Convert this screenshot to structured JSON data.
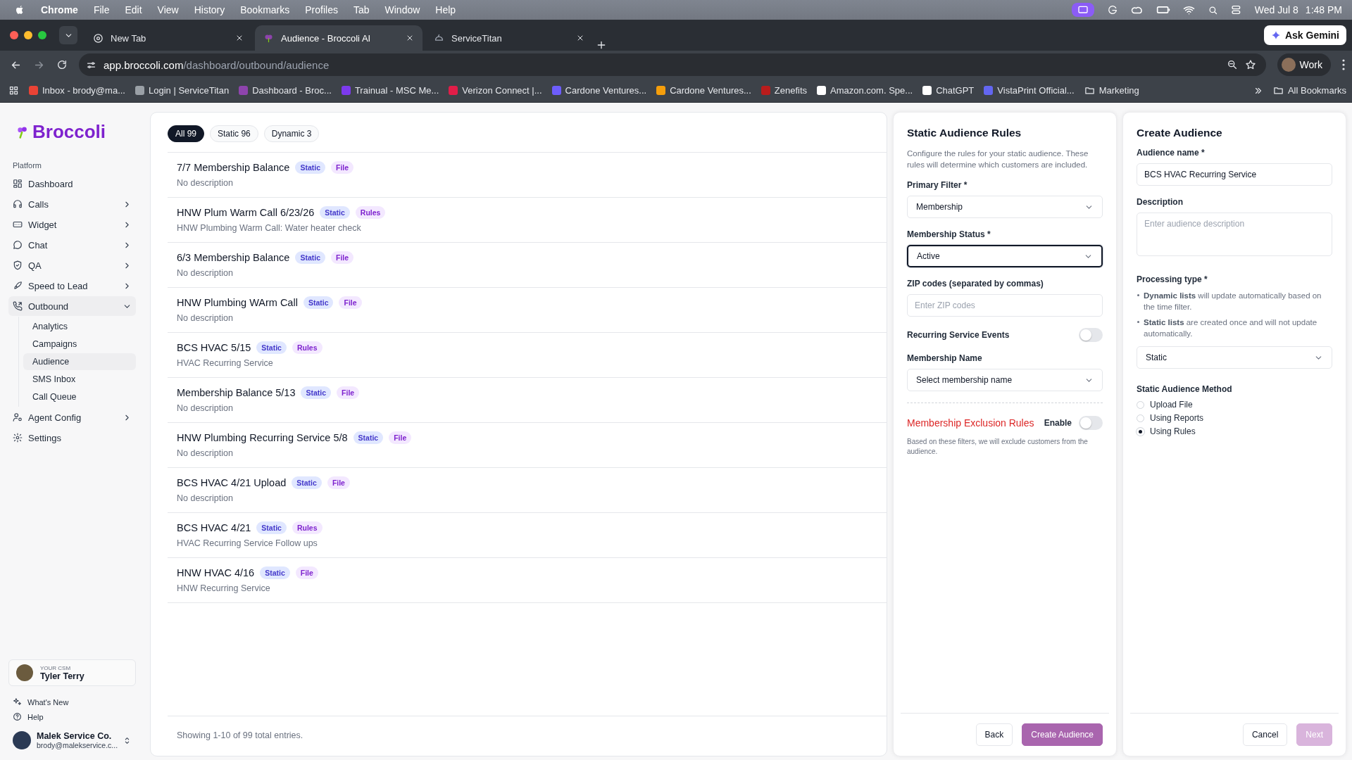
{
  "menubar": {
    "app": "Chrome",
    "items": [
      "File",
      "Edit",
      "View",
      "History",
      "Bookmarks",
      "Profiles",
      "Tab",
      "Window",
      "Help"
    ],
    "date": "Wed Jul 8",
    "time": "1:48 PM"
  },
  "browser_tabs": [
    {
      "title": "New Tab",
      "selected": false
    },
    {
      "title": "Audience - Broccoli AI",
      "selected": true
    },
    {
      "title": "ServiceTitan",
      "selected": false
    }
  ],
  "ask_gemini": "Ask Gemini",
  "address": {
    "host": "app.broccoli.com",
    "path": "/dashboard/outbound/audience"
  },
  "profile": "Work",
  "bookmarks": [
    "Inbox - brody@ma...",
    "Login | ServiceTitan",
    "Dashboard - Broc...",
    "Trainual - MSC Me...",
    "Verizon Connect |...",
    "Cardone Ventures...",
    "Cardone Ventures...",
    "Zenefits",
    "Amazon.com. Spe...",
    "ChatGPT",
    "VistaPrint Official...",
    "Marketing"
  ],
  "all_bookmarks": "All Bookmarks",
  "sidebar": {
    "brand": "Broccoli",
    "section": "Platform",
    "items": [
      {
        "label": "Dashboard",
        "kind": "link"
      },
      {
        "label": "Calls",
        "kind": "group",
        "expanded": false
      },
      {
        "label": "Widget",
        "kind": "group",
        "expanded": false
      },
      {
        "label": "Chat",
        "kind": "group",
        "expanded": false
      },
      {
        "label": "QA",
        "kind": "group",
        "expanded": false
      },
      {
        "label": "Speed to Lead",
        "kind": "group",
        "expanded": false
      },
      {
        "label": "Outbound",
        "kind": "group",
        "expanded": true,
        "children": [
          {
            "label": "Analytics",
            "selected": false
          },
          {
            "label": "Campaigns",
            "selected": false
          },
          {
            "label": "Audience",
            "selected": true
          },
          {
            "label": "SMS Inbox",
            "selected": false
          },
          {
            "label": "Call Queue",
            "selected": false
          }
        ]
      },
      {
        "label": "Agent Config",
        "kind": "group",
        "expanded": false
      },
      {
        "label": "Settings",
        "kind": "link"
      }
    ],
    "csm": {
      "caption": "YOUR CSM",
      "name": "Tyler Terry"
    },
    "footer_links": [
      "What's New",
      "Help"
    ],
    "account": {
      "name": "Malek Service Co.",
      "email": "brody@malekservice.c..."
    }
  },
  "filters": [
    {
      "label": "All 99",
      "selected": true
    },
    {
      "label": "Static 96",
      "selected": false
    },
    {
      "label": "Dynamic 3",
      "selected": false
    }
  ],
  "audiences": [
    {
      "title": "7/7 Membership Balance",
      "tags": [
        {
          "label": "Static",
          "kind": "type"
        },
        {
          "label": "File",
          "kind": "source"
        }
      ],
      "description": "No description"
    },
    {
      "title": "HNW Plum Warm Call 6/23/26",
      "tags": [
        {
          "label": "Static",
          "kind": "type"
        },
        {
          "label": "Rules",
          "kind": "source"
        }
      ],
      "description": "HNW Plumbing Warm Call: Water heater check"
    },
    {
      "title": "6/3 Membership Balance",
      "tags": [
        {
          "label": "Static",
          "kind": "type"
        },
        {
          "label": "File",
          "kind": "source"
        }
      ],
      "description": "No description"
    },
    {
      "title": "HNW Plumbing WArm Call",
      "tags": [
        {
          "label": "Static",
          "kind": "type"
        },
        {
          "label": "File",
          "kind": "source"
        }
      ],
      "description": "No description"
    },
    {
      "title": "BCS HVAC 5/15",
      "tags": [
        {
          "label": "Static",
          "kind": "type"
        },
        {
          "label": "Rules",
          "kind": "source"
        }
      ],
      "description": "HVAC Recurring Service"
    },
    {
      "title": "Membership Balance 5/13",
      "tags": [
        {
          "label": "Static",
          "kind": "type"
        },
        {
          "label": "File",
          "kind": "source"
        }
      ],
      "description": "No description"
    },
    {
      "title": "HNW Plumbing Recurring Service 5/8",
      "tags": [
        {
          "label": "Static",
          "kind": "type"
        },
        {
          "label": "File",
          "kind": "source"
        }
      ],
      "description": "No description"
    },
    {
      "title": "BCS HVAC 4/21 Upload",
      "tags": [
        {
          "label": "Static",
          "kind": "type"
        },
        {
          "label": "File",
          "kind": "source"
        }
      ],
      "description": "No description"
    },
    {
      "title": "BCS HVAC 4/21",
      "tags": [
        {
          "label": "Static",
          "kind": "type"
        },
        {
          "label": "Rules",
          "kind": "source"
        }
      ],
      "description": "HVAC Recurring Service Follow ups"
    },
    {
      "title": "HNW HVAC 4/16",
      "tags": [
        {
          "label": "Static",
          "kind": "type"
        },
        {
          "label": "File",
          "kind": "source"
        }
      ],
      "description": "HNW Recurring Service"
    }
  ],
  "list_footer": "Showing 1-10 of 99 total entries.",
  "rules_panel": {
    "title": "Static Audience Rules",
    "description": "Configure the rules for your static audience. These rules will determine which customers are included.",
    "fields": [
      {
        "kind": "select",
        "label": "Primary Filter *",
        "value": "Membership",
        "focused": false
      },
      {
        "kind": "select",
        "label": "Membership Status *",
        "value": "Active",
        "focused": true
      },
      {
        "kind": "input",
        "label": "ZIP codes (separated by commas)",
        "placeholder": "Enter ZIP codes"
      },
      {
        "kind": "toggle",
        "label": "Recurring Service Events",
        "on": false
      },
      {
        "kind": "select",
        "label": "Membership Name",
        "value": "Select membership name",
        "focused": false
      }
    ],
    "exclusion": {
      "title": "Membership Exclusion Rules",
      "enable_label": "Enable",
      "on": false,
      "note": "Based on these filters, we will exclude customers from the audience."
    },
    "back": "Back",
    "submit": "Create Audience"
  },
  "create_panel": {
    "title": "Create Audience",
    "name_field": {
      "label": "Audience name *",
      "value": "BCS HVAC Recurring Service"
    },
    "description_field": {
      "label": "Description",
      "placeholder": "Enter audience description"
    },
    "processing": {
      "label": "Processing type *",
      "bullets": [
        "**Dynamic lists** will update automatically based on the time filter.",
        "**Static lists** are created once and will not update automatically."
      ],
      "value": "Static"
    },
    "method": {
      "label": "Static Audience Method",
      "options": [
        {
          "label": "Upload File",
          "selected": false
        },
        {
          "label": "Using Reports",
          "selected": false
        },
        {
          "label": "Using Rules",
          "selected": true
        }
      ]
    },
    "cancel": "Cancel",
    "next": {
      "label": "Next",
      "disabled": true
    }
  }
}
